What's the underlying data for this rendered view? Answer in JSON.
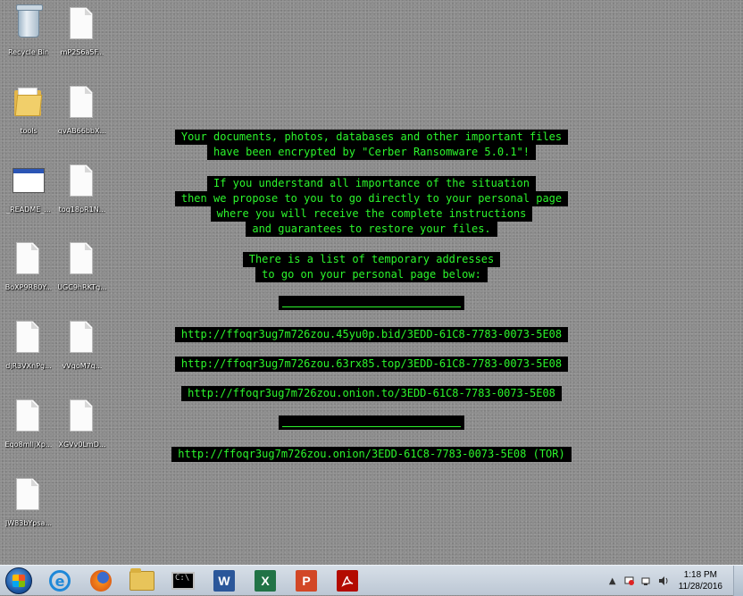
{
  "desktop_icons": [
    {
      "label": "Recycle Bin",
      "icon": "recycle-bin-icon"
    },
    {
      "label": "mP2S6a5F...",
      "icon": "document-icon"
    },
    {
      "label": "tools",
      "icon": "folder-icon"
    },
    {
      "label": "qvAB66bbX...",
      "icon": "document-icon"
    },
    {
      "label": "_README_...",
      "icon": "window-app-icon"
    },
    {
      "label": "toq18pR1N...",
      "icon": "document-icon"
    },
    {
      "label": "BoXP9R80Y...",
      "icon": "document-icon"
    },
    {
      "label": "UGC9hRKTg...",
      "icon": "document-icon"
    },
    {
      "label": "djR3VXnPg...",
      "icon": "document-icon"
    },
    {
      "label": "vVqoM7q...",
      "icon": "document-icon"
    },
    {
      "label": "Eqo8mlIjXp...",
      "icon": "document-icon"
    },
    {
      "label": "XGVv0LmD...",
      "icon": "document-icon"
    },
    {
      "label": "JW83bYpsa...",
      "icon": "document-icon"
    }
  ],
  "note": {
    "line1": "Your documents, photos, databases and other important files",
    "line2": "have been encrypted by \"Cerber Ransomware 5.0.1\"!",
    "line3": "If you understand all importance of the situation",
    "line4": "then we propose to you to go directly to your personal page",
    "line5": "where you will receive the complete instructions",
    "line6": "and guarantees to restore your files.",
    "line7": "There is a list of temporary addresses",
    "line8": "to go on your personal page below:",
    "url1": "http://ffoqr3ug7m726zou.45yu0p.bid/3EDD-61C8-7783-0073-5E08",
    "url2": "http://ffoqr3ug7m726zou.63rx85.top/3EDD-61C8-7783-0073-5E08",
    "url3": "http://ffoqr3ug7m726zou.onion.to/3EDD-61C8-7783-0073-5E08",
    "url4": "http://ffoqr3ug7m726zou.onion/3EDD-61C8-7783-0073-5E08 (TOR)",
    "text_color": "#2cf52c"
  },
  "taskbar": {
    "pinned": [
      "start-orb",
      "internet-explorer-icon",
      "firefox-icon",
      "file-explorer-icon",
      "command-prompt-icon",
      "word-icon",
      "excel-icon",
      "powerpoint-icon",
      "acrobat-icon"
    ],
    "word_letter": "W",
    "excel_letter": "X",
    "ppt_letter": "P",
    "cmd_text": "C:\\",
    "ie_letter": "e"
  },
  "tray": {
    "time": "1:18 PM",
    "date": "11/28/2016"
  }
}
